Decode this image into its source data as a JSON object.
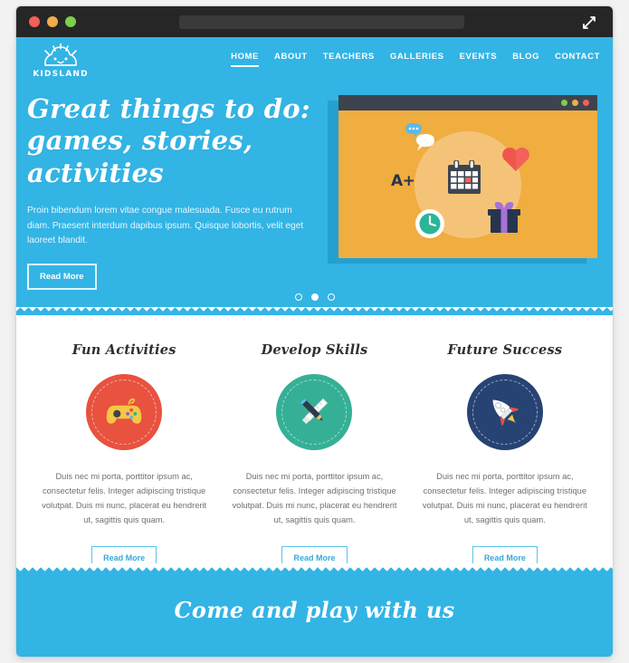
{
  "window": {
    "traffic_lights": [
      "close",
      "minimize",
      "zoom"
    ],
    "url_value": "",
    "expand_icon": "expand-diagonal-icon"
  },
  "site": {
    "logo_text": "KIDSLAND",
    "logo_icon": "sun-face-icon",
    "accent_blue": "#32b4e5",
    "nav": [
      {
        "label": "HOME",
        "active": true
      },
      {
        "label": "ABOUT",
        "active": false
      },
      {
        "label": "TEACHERS",
        "active": false
      },
      {
        "label": "GALLERIES",
        "active": false
      },
      {
        "label": "EVENTS",
        "active": false
      },
      {
        "label": "BLOG",
        "active": false
      },
      {
        "label": "CONTACT",
        "active": false
      }
    ]
  },
  "hero": {
    "heading_line1": "Great things to do:",
    "heading_line2": "games, stories, activities",
    "paragraph": "Proin bibendum lorem vitae congue malesuada. Fusce eu rutrum diam. Praesent interdum dapibus ipsum. Quisque lobortis, velit eget laoreet blandit.",
    "button_label": "Read More",
    "illustration": {
      "window_bg": "#f0ad40",
      "titlebar_bg": "#3d4450",
      "dots": [
        "#7bcf4c",
        "#eeae4a",
        "#f4605a"
      ],
      "icons": [
        "speech-bubble-icon",
        "heart-icon",
        "grade-a-plus-label",
        "calendar-icon",
        "clock-icon",
        "gift-icon"
      ],
      "grade_label": "A+"
    },
    "slider_dots": [
      {
        "active": false
      },
      {
        "active": true
      },
      {
        "active": false
      }
    ]
  },
  "features": [
    {
      "title": "Fun Activities",
      "icon": "gamepad-icon",
      "badge_color": "#e8523f",
      "text": "Duis nec mi porta, porttitor ipsum ac, consectetur felis. Integer adipiscing tristique volutpat. Duis mi nunc, placerat eu hendrerit ut, sagittis quis quam.",
      "button_label": "Read More"
    },
    {
      "title": "Develop Skills",
      "icon": "pencil-ruler-icon",
      "badge_color": "#35b096",
      "text": "Duis nec mi porta, porttitor ipsum ac, consectetur felis. Integer adipiscing tristique volutpat. Duis mi nunc, placerat eu hendrerit ut, sagittis quis quam.",
      "button_label": "Read More"
    },
    {
      "title": "Future Success",
      "icon": "rocket-icon",
      "badge_color": "#264373",
      "text": "Duis nec mi porta, porttitor ipsum ac, consectetur felis. Integer adipiscing tristique volutpat. Duis mi nunc, placerat eu hendrerit ut, sagittis quis quam.",
      "button_label": "Read More"
    }
  ],
  "cta": {
    "heading": "Come and play with us"
  }
}
